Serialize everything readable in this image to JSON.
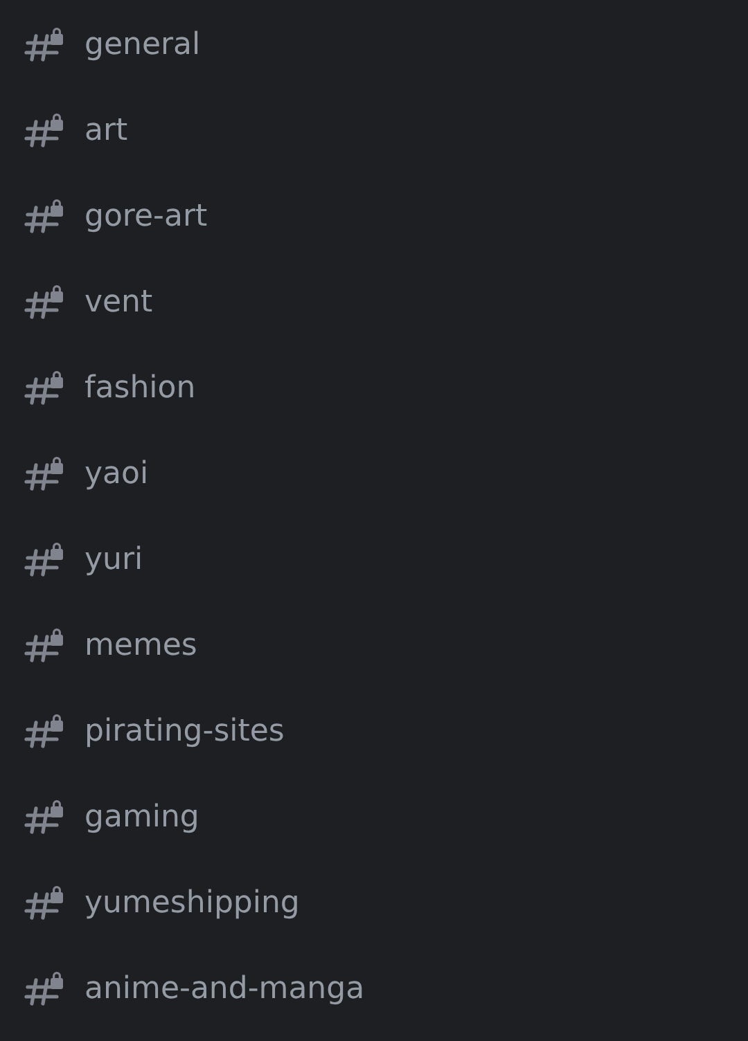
{
  "channels": [
    {
      "name": "general",
      "locked": true
    },
    {
      "name": "art",
      "locked": true
    },
    {
      "name": "gore-art",
      "locked": true
    },
    {
      "name": "vent",
      "locked": true
    },
    {
      "name": "fashion",
      "locked": true
    },
    {
      "name": "yaoi",
      "locked": true
    },
    {
      "name": "yuri",
      "locked": true
    },
    {
      "name": "memes",
      "locked": true
    },
    {
      "name": "pirating-sites",
      "locked": true
    },
    {
      "name": "gaming",
      "locked": true
    },
    {
      "name": "yumeshipping",
      "locked": true
    },
    {
      "name": "anime-and-manga",
      "locked": true
    }
  ]
}
